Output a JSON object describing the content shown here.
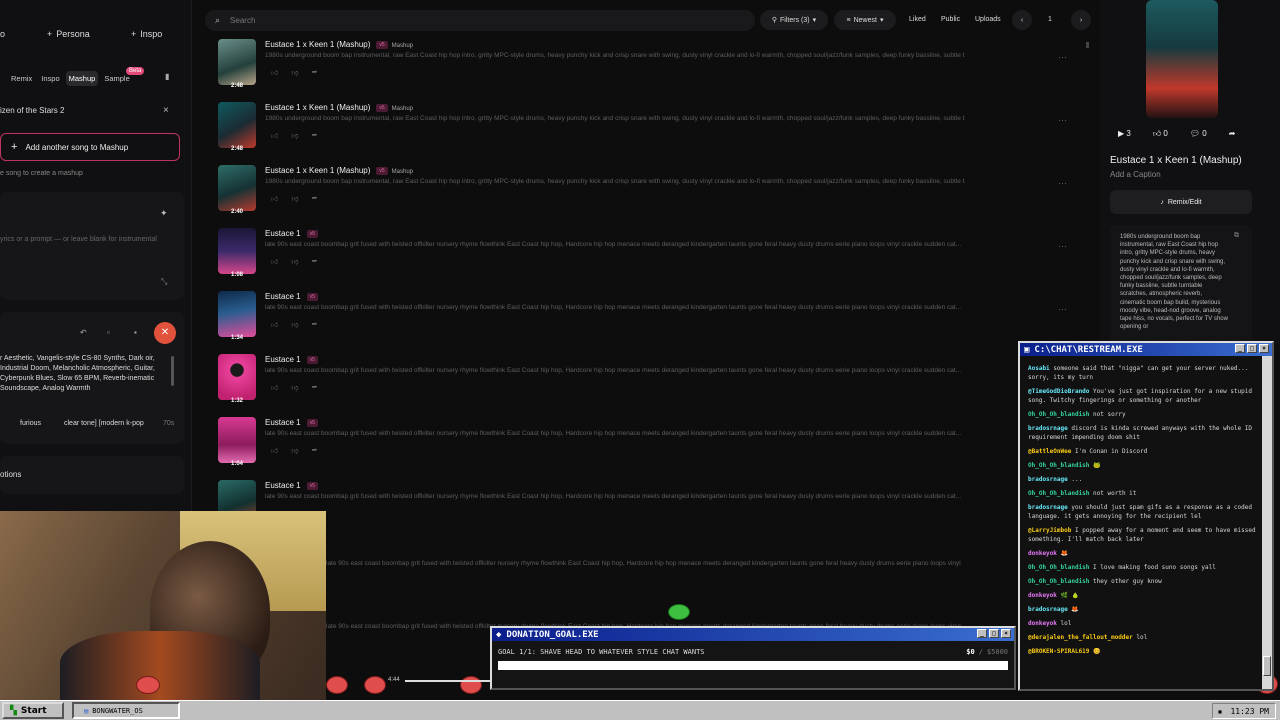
{
  "left": {
    "top_buttons": [
      {
        "label": "o"
      },
      {
        "label": "Persona"
      },
      {
        "label": "Inspo"
      }
    ],
    "modes": [
      {
        "label": "Remix"
      },
      {
        "label": "Inspo"
      },
      {
        "label": "Mashup"
      },
      {
        "label": "Sample"
      }
    ],
    "beta": "Beta",
    "mashup_song": "izen of the Stars 2",
    "add_song": "Add another song to Mashup",
    "hint": "e song to create a mashup",
    "lyrics_placeholder": "yrics or a prompt — or leave blank for instrumental",
    "styles_text": "r Aesthetic, Vangelis-style CS-80 Synths, Dark oir, Industrial Doom, Melancholic Atmospheric, Guitar, Cyberpunk Blues, Slow 65 BPM, Reverb-inematic Soundscape, Analog Warmth",
    "tags": [
      {
        "label": "furious"
      },
      {
        "label": "clear tone] [modern k-pop"
      },
      {
        "label": "70s"
      }
    ],
    "options": "otions"
  },
  "topbar": {
    "search_placeholder": "Search",
    "filters": "Filters (3)",
    "sort": "Newest",
    "links": [
      {
        "label": "Liked"
      },
      {
        "label": "Public"
      },
      {
        "label": "Uploads"
      }
    ],
    "page": "1"
  },
  "songs": [
    {
      "title": "Eustace 1 x Keen 1 (Mashup)",
      "badge": "v5",
      "tag": "Mashup",
      "duration": "2:48",
      "desc": "1980s underground boom bap instrumental, raw East Coast hip hop intro, gritty MPC-style drums, heavy punchy kick and crisp snare with swing, dusty vinyl crackle and lo-fi warmth, chopped soul/jazz/funk samples, deep funky bassline, subtle t..."
    },
    {
      "title": "Eustace 1 x Keen 1 (Mashup)",
      "badge": "v5",
      "tag": "Mashup",
      "duration": "2:48",
      "desc": "1980s underground boom bap instrumental, raw East Coast hip hop intro, gritty MPC-style drums, heavy punchy kick and crisp snare with swing, dusty vinyl crackle and lo-fi warmth, chopped soul/jazz/funk samples, deep funky bassline, subtle t..."
    },
    {
      "title": "Eustace 1 x Keen 1 (Mashup)",
      "badge": "v5",
      "tag": "Mashup",
      "duration": "2:40",
      "desc": "1980s underground boom bap instrumental, raw East Coast hip hop intro, gritty MPC-style drums, heavy punchy kick and crisp snare with swing, dusty vinyl crackle and lo-fi warmth, chopped soul/jazz/funk samples, deep funky bassline, subtle t..."
    },
    {
      "title": "Eustace 1",
      "badge": "v5",
      "tag": "",
      "duration": "1:08",
      "desc": "late 90s east coast boombap grit fused with twisted offkilter nursery rhyme flowthink East Coast hip hop, Hardcore hip hop menace meets deranged kindergarten taunts gone feral heavy dusty drums eerie piano loops vinyl crackle sudden cat..."
    },
    {
      "title": "Eustace 1",
      "badge": "v5",
      "tag": "",
      "duration": "1:34",
      "desc": "late 90s east coast boombap grit fused with twisted offkilter nursery rhyme flowthink East Coast hip hop, Hardcore hip hop menace meets deranged kindergarten taunts gone feral heavy dusty drums eerie piano loops vinyl crackle sudden cat..."
    },
    {
      "title": "Eustace 1",
      "badge": "v5",
      "tag": "",
      "duration": "1:32",
      "desc": "late 90s east coast boombap grit fused with twisted offkilter nursery rhyme flowthink East Coast hip hop, Hardcore hip hop menace meets deranged kindergarten taunts gone feral heavy dusty drums eerie piano loops vinyl crackle sudden cat..."
    },
    {
      "title": "Eustace 1",
      "badge": "v5",
      "tag": "",
      "duration": "1:04",
      "desc": "late 90s east coast boombap grit fused with twisted offkilter nursery rhyme flowthink East Coast hip hop, Hardcore hip hop menace meets deranged kindergarten taunts gone feral heavy dusty drums eerie piano loops vinyl crackle sudden cat..."
    },
    {
      "title": "Eustace 1",
      "badge": "v5",
      "tag": "",
      "duration": "",
      "desc": "late 90s east coast boombap grit fused with twisted offkilter nursery rhyme flowthink East Coast hip hop, Hardcore hip hop menace meets deranged kindergarten taunts gone feral heavy dusty drums eerie piano loops vinyl crackle sudden cat..."
    }
  ],
  "extra_desc": [
    "late 90s east coast boombap grit fused with twisted offkilter nursery rhyme flowthink East Coast hip hop, Hardcore hip hop menace meets deranged kindergarten taunts gone feral heavy dusty drums eerie piano loops vinyl crackle sudden cat...",
    "late 90s east coast boombap grit fused with twisted offkilter nursery rhyme flowthink East Coast hip hop, Hardcore hip hop menace meets deranged kindergarten taunts gone feral heavy dusty drums eerie piano loops vinyl crackle sudden cat..."
  ],
  "right": {
    "plays": "3",
    "likes": "0",
    "comments": "0",
    "title": "Eustace 1 x Keen 1 (Mashup)",
    "caption": "Add a Caption",
    "remix": "Remix/Edit",
    "desc": "1980s underground boom bap instrumental, raw East Coast hip hop intro, gritty MPC-style drums, heavy punchy kick and crisp snare with swing, dusty vinyl crackle and lo-fi warmth, chopped soul/jazz/funk samples, deep funky bassline, subtle turntable scratches, atmospheric reverb, cinematic boom bap build, mysterious moody vibe, head-nod groove, analog tape hiss, no vocals, perfect for TV show opening or"
  },
  "chat": {
    "title": "C:\\CHAT\\RESTREAM.EXE",
    "messages": [
      {
        "user": "Aosabi",
        "text": "someone said that \"nigga\" can get your server nuked... sorry, its my turn",
        "cls": "c"
      },
      {
        "user": "@TimeGodDioBrando",
        "text": "You've just got inspiration for a new stupid song. Twitchy fingerings or something or another",
        "cls": "c"
      },
      {
        "user": "Oh_Oh_Oh_blandish",
        "text": "not sorry",
        "cls": ""
      },
      {
        "user": "bradosrnage",
        "text": "discord is kinda screwed anyways with the whole ID requirement impending doom shit",
        "cls": "c"
      },
      {
        "user": "@BattleOnWee",
        "text": "I'm Conan in Discord",
        "cls": "y"
      },
      {
        "user": "Oh_Oh_Oh_blandish",
        "text": "🐸",
        "cls": ""
      },
      {
        "user": "bradosrnage",
        "text": "...",
        "cls": "c"
      },
      {
        "user": "Oh_Oh_Oh_blandish",
        "text": "not worth it",
        "cls": ""
      },
      {
        "user": "bradosrnage",
        "text": "you should just spam gifs as a response as a coded language. it gets annoying for the recipient lel",
        "cls": "c"
      },
      {
        "user": "@LarryJimbob",
        "text": "I popped away for a moment and seem to have missed something. I'll match back later",
        "cls": "y"
      },
      {
        "user": "donkeyok",
        "text": "🦊",
        "cls": "p"
      },
      {
        "user": "Oh_Oh_Oh_blandish",
        "text": "I love making food suno songs yall",
        "cls": ""
      },
      {
        "user": "Oh_Oh_Oh_blandish",
        "text": "they other guy know",
        "cls": ""
      },
      {
        "user": "donkeyok",
        "text": "🌿 🍐",
        "cls": "p"
      },
      {
        "user": "bradosrnage",
        "text": "🦊",
        "cls": "c"
      },
      {
        "user": "donkeyok",
        "text": "lol",
        "cls": "p"
      },
      {
        "user": "@derajalen_the_fallout_modder",
        "text": "lol",
        "cls": "y"
      },
      {
        "user": "@BROKEN-SPIRAL619",
        "text": "😊",
        "cls": "y"
      }
    ]
  },
  "donation": {
    "title": "DONATION_GOAL.EXE",
    "goal": "GOAL 1/1: SHAVE HEAD TO WHATEVER STYLE CHAT WANTS",
    "raised": "$0",
    "sep": "/",
    "target": "$5000",
    "progress": 0.0
  },
  "player": {
    "time": "4:44"
  },
  "taskbar": {
    "start": "Start",
    "app": "BONGWATER_OS",
    "clock": "11:23 PM"
  }
}
